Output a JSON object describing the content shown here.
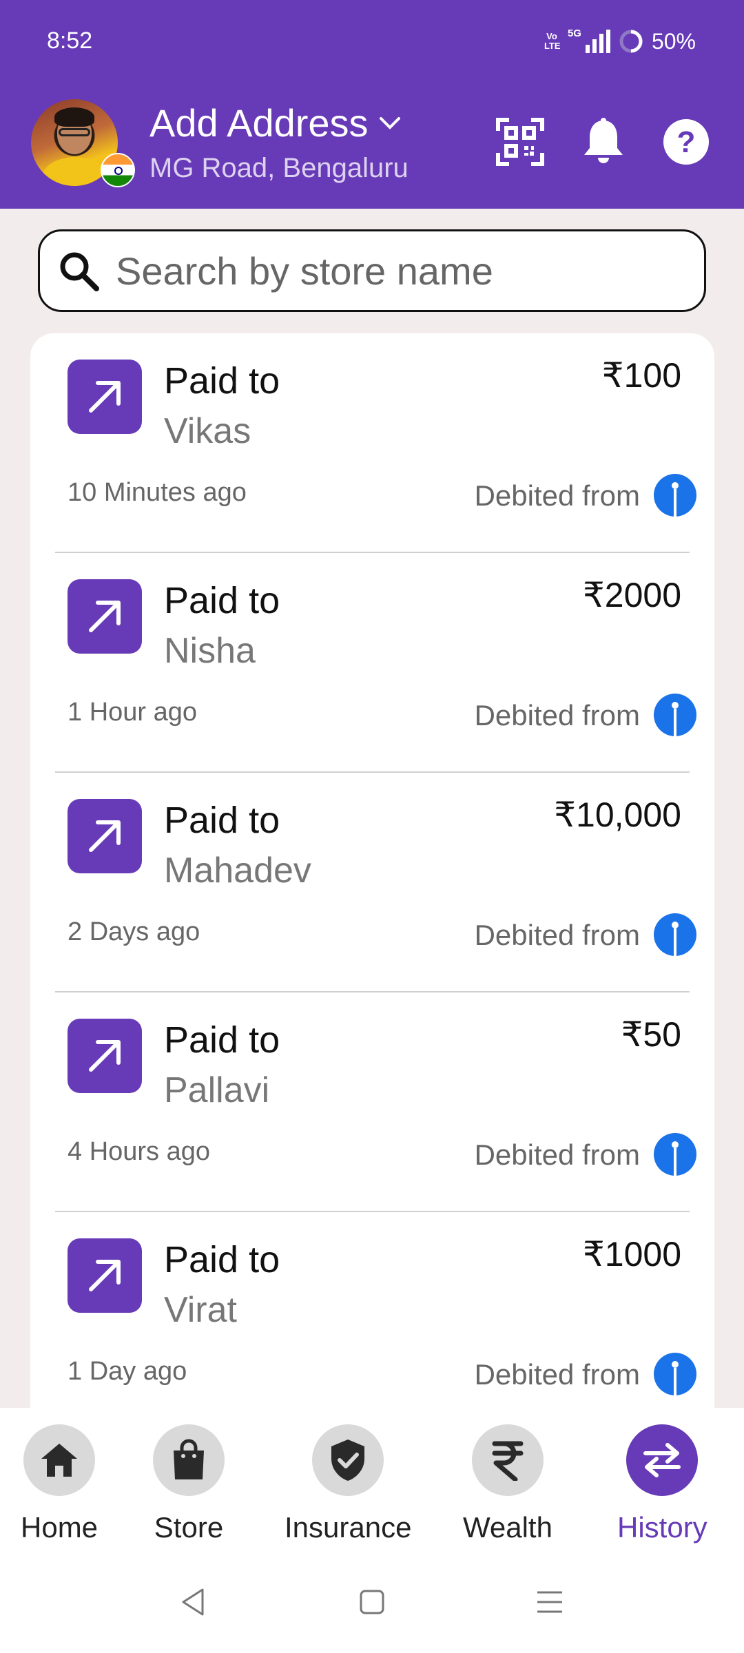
{
  "status_bar": {
    "time": "8:52",
    "volte": "Vo LTE",
    "network": "5G",
    "battery": "50%"
  },
  "header": {
    "title": "Add Address",
    "subtitle": "MG Road, Bengaluru",
    "icons": [
      "qr-scanner-icon",
      "notification-bell-icon",
      "help-icon"
    ]
  },
  "search": {
    "placeholder": "Search by store name"
  },
  "transactions": [
    {
      "title": "Paid to",
      "name": "Vikas",
      "amount": "₹100",
      "time": "10 Minutes ago",
      "debited": "Debited from"
    },
    {
      "title": "Paid to",
      "name": "Nisha",
      "amount": "₹2000",
      "time": "1 Hour ago",
      "debited": "Debited from"
    },
    {
      "title": "Paid to",
      "name": "Mahadev",
      "amount": "₹10,000",
      "time": "2 Days ago",
      "debited": "Debited from"
    },
    {
      "title": "Paid to",
      "name": "Pallavi",
      "amount": "₹50",
      "time": "4 Hours ago",
      "debited": "Debited from"
    },
    {
      "title": "Paid to",
      "name": "Virat",
      "amount": "₹1000",
      "time": "1 Day ago",
      "debited": "Debited from"
    }
  ],
  "bottom_nav": [
    {
      "label": "Home",
      "icon": "home-icon"
    },
    {
      "label": "Store",
      "icon": "shopping-bag-icon"
    },
    {
      "label": "Insurance",
      "icon": "shield-check-icon"
    },
    {
      "label": "Wealth",
      "icon": "rupee-icon"
    },
    {
      "label": "History",
      "icon": "transfer-arrows-icon",
      "active": true
    }
  ],
  "colors": {
    "brand": "#673ab7",
    "background": "#f3ecec",
    "bank": "#1a73e8"
  }
}
